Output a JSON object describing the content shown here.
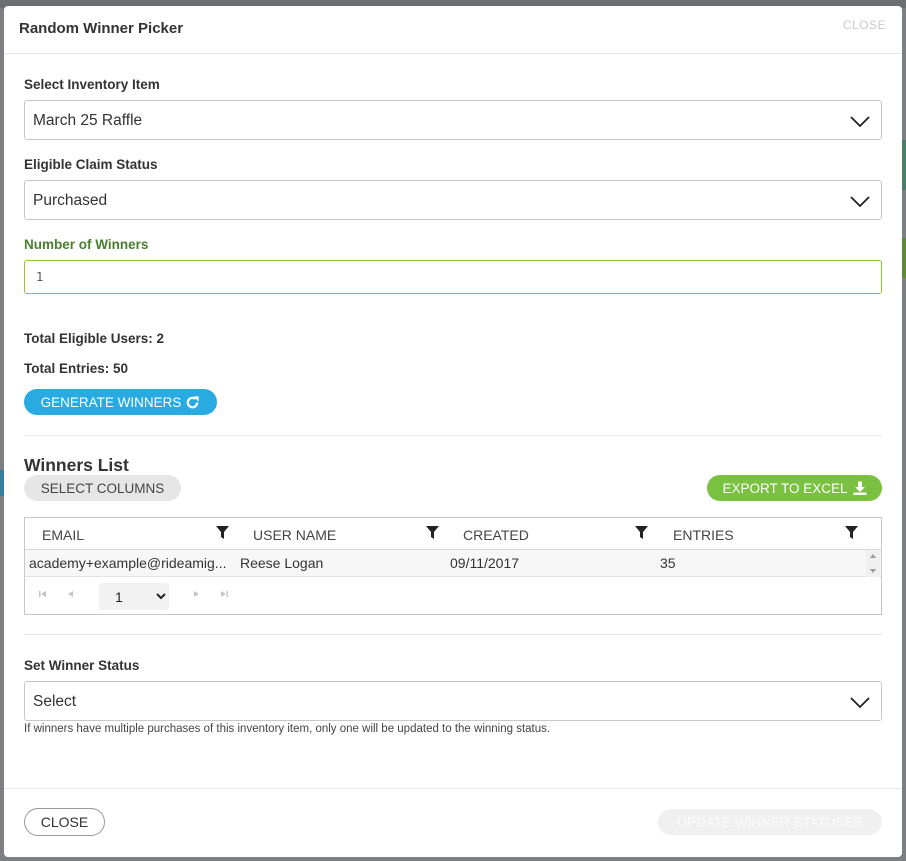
{
  "modal": {
    "title": "Random Winner Picker",
    "close_label": "CLOSE"
  },
  "inventory": {
    "label": "Select Inventory Item",
    "value": "March 25 Raffle"
  },
  "claim_status": {
    "label": "Eligible Claim Status",
    "value": "Purchased"
  },
  "winners_count": {
    "label": "Number of Winners",
    "value": "1"
  },
  "stats": {
    "eligible_users": "Total Eligible Users: 2",
    "total_entries": "Total Entries: 50"
  },
  "generate_label": "GENERATE WINNERS",
  "winners_list": {
    "title": "Winners List",
    "select_columns_label": "SELECT COLUMNS",
    "export_label": "EXPORT TO EXCEL",
    "columns": [
      "EMAIL",
      "USER NAME",
      "CREATED",
      "ENTRIES"
    ],
    "rows": [
      {
        "email": "academy+example@rideamig...",
        "username": "Reese Logan",
        "created": "09/11/2017",
        "entries": "35"
      }
    ],
    "page": "1"
  },
  "winner_status": {
    "label": "Set Winner Status",
    "value": "Select",
    "note": "If winners have multiple purchases of this inventory item, only one will be updated to the winning status."
  },
  "footer": {
    "close_label": "CLOSE",
    "update_label": "UPDATE WINNER STATUSES"
  },
  "colors": {
    "primary": "#29abe2",
    "success": "#7ac142",
    "field_focus": "#8cc63f",
    "label_green": "#4a7f2e"
  },
  "icons": [
    "chevron-down-icon",
    "refresh-icon",
    "download-icon",
    "filter-icon",
    "first-page-icon",
    "prev-page-icon",
    "next-page-icon",
    "last-page-icon"
  ]
}
